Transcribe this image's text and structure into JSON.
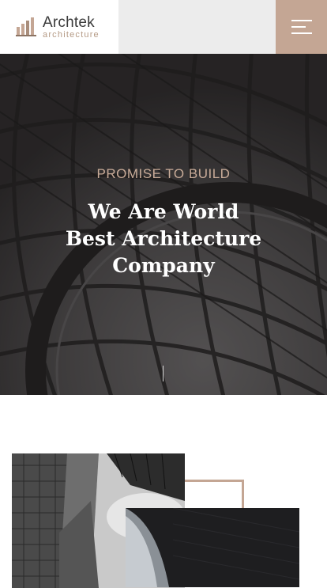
{
  "header": {
    "brand_name": "Archtek",
    "brand_sub": "architecture",
    "logo_icon": "building-bars-icon",
    "menu_icon": "hamburger-menu-icon"
  },
  "hero": {
    "tagline": "PROMISE TO BUILD",
    "title_line1": "We Are World",
    "title_line2": "Best Architecture",
    "title_line3": "Company"
  },
  "colors": {
    "accent": "#c4a694",
    "header_bg": "#ececec",
    "hero_text": "#ffffff"
  }
}
